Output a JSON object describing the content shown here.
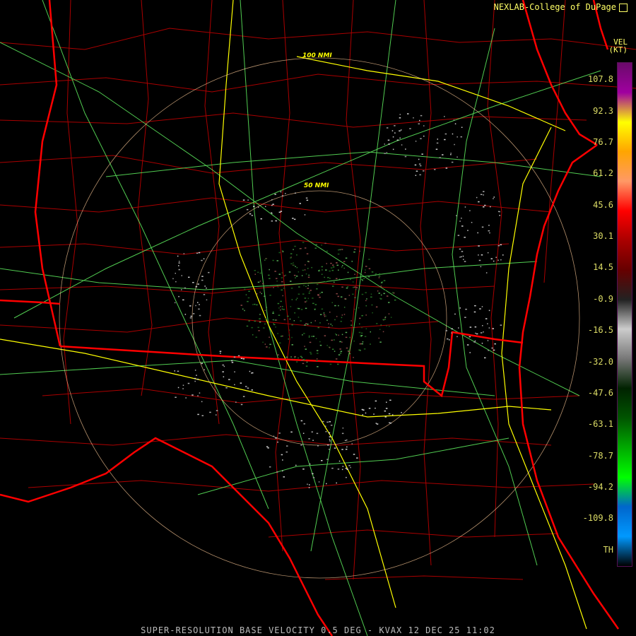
{
  "header": {
    "credit": "NEXLAB-College of DuPage",
    "units_code": "VEL",
    "units_label": "(KT)"
  },
  "map": {
    "range_rings": [
      {
        "label": "50 NMI"
      },
      {
        "label": "100 NMI"
      }
    ],
    "colors": {
      "state_border": "#ff0000",
      "county_border": "#aa0000",
      "highway": "#ffff00",
      "road": "#66ff66",
      "range_ring": "#ffcc99"
    }
  },
  "legend": {
    "ticks": [
      "107.8",
      "92.3",
      "76.7",
      "61.2",
      "45.6",
      "30.1",
      "14.5",
      "-0.9",
      "-16.5",
      "-32.0",
      "-47.6",
      "-63.1",
      "-78.7",
      "-94.2",
      "-109.8",
      "TH"
    ],
    "colors": [
      "#6a0a6a",
      "#a000a0",
      "#ffff00",
      "#ffa500",
      "#ff9966",
      "#ff0000",
      "#aa0000",
      "#660000",
      "#222222",
      "#cccccc",
      "#777777",
      "#002200",
      "#005500",
      "#00aa00",
      "#00ff00",
      "#0066cc",
      "#0099ff",
      "#000000"
    ]
  },
  "footer": {
    "title": "SUPER-RESOLUTION BASE VELOCITY 0.5 DEG - KVAX 12 DEC 25 11:02"
  }
}
